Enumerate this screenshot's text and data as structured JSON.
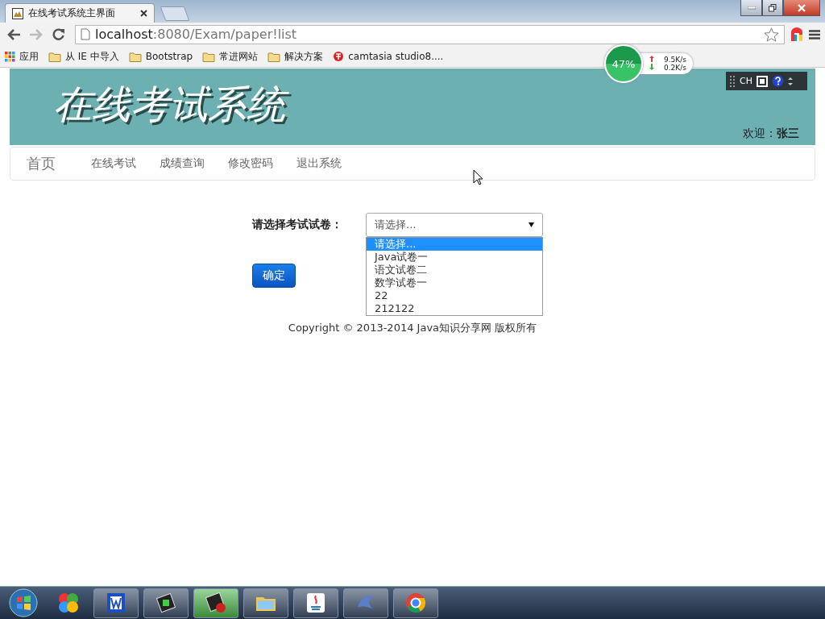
{
  "browser": {
    "tab_title": "在线考试系统主界面",
    "url_host": "localhost",
    "url_path": ":8080/Exam/paper!list",
    "bookmarks": [
      {
        "label": "应用",
        "kind": "apps"
      },
      {
        "label": "从 IE 中导入",
        "kind": "folder"
      },
      {
        "label": "Bootstrap",
        "kind": "folder"
      },
      {
        "label": "常进网站",
        "kind": "folder"
      },
      {
        "label": "解决方案",
        "kind": "folder"
      },
      {
        "label": "camtasia studio8....",
        "kind": "site"
      }
    ]
  },
  "net_widget": {
    "percent": "47%",
    "upload": "9.5K/s",
    "download": "0.2K/s"
  },
  "ime_bar": {
    "label": "CH"
  },
  "header": {
    "title": "在线考试系统",
    "welcome": "欢迎：",
    "user": "张三"
  },
  "nav": [
    {
      "label": "首页",
      "kind": "brand"
    },
    {
      "label": "在线考试",
      "kind": "link"
    },
    {
      "label": "成绩查询",
      "kind": "link"
    },
    {
      "label": "修改密码",
      "kind": "link"
    },
    {
      "label": "退出系统",
      "kind": "link"
    }
  ],
  "form": {
    "label": "请选择考试试卷：",
    "value": "请选择...",
    "button": "确定",
    "options": [
      {
        "label": "请选择...",
        "selected": true
      },
      {
        "label": "Java试卷一",
        "selected": false
      },
      {
        "label": "语文试卷二",
        "selected": false
      },
      {
        "label": "数学试卷一",
        "selected": false
      },
      {
        "label": "22",
        "selected": false
      },
      {
        "label": "212122",
        "selected": false
      }
    ]
  },
  "footer": {
    "copyright": "Copyright © 2013-2014 Java知识分享网 版权所有"
  }
}
